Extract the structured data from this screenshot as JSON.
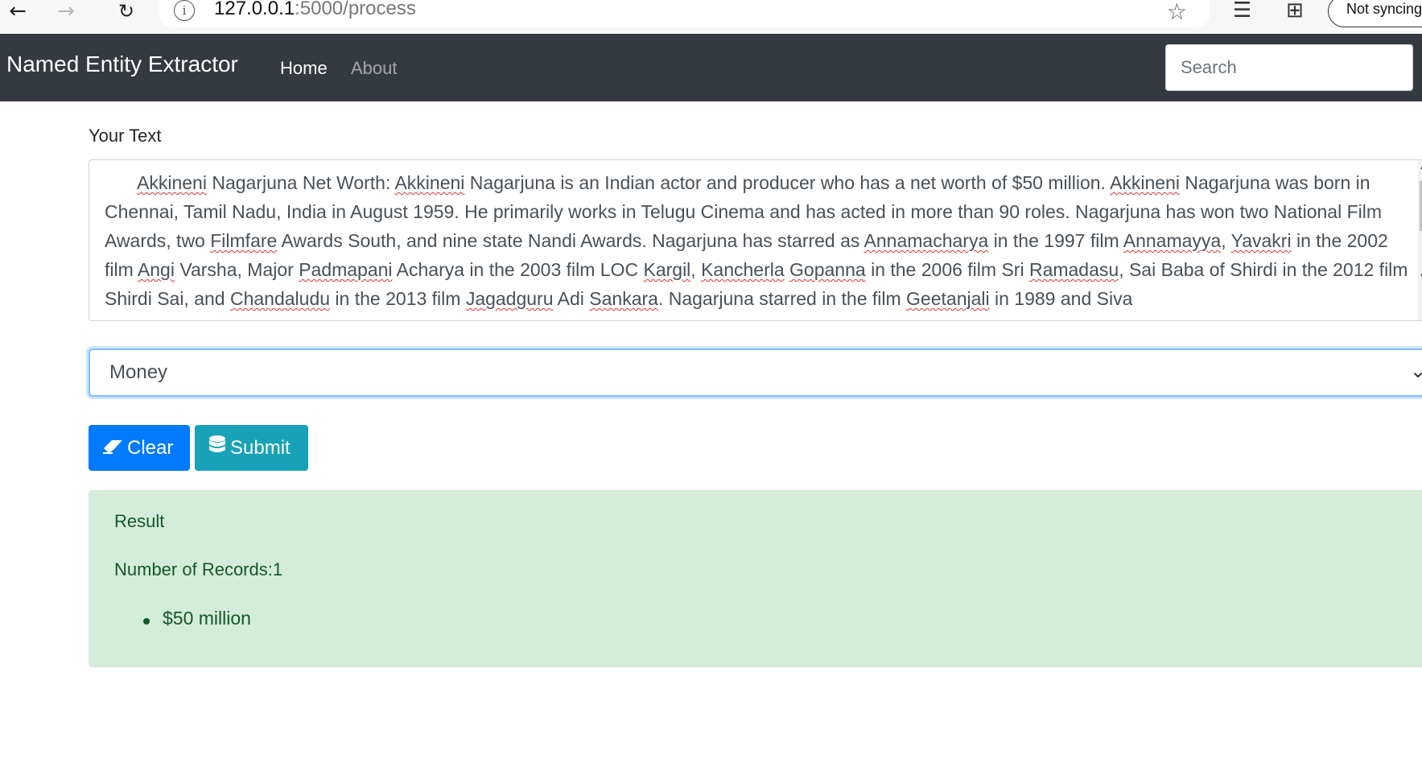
{
  "browser": {
    "url_host": "127.0.0.1",
    "url_path": ":5000/process",
    "sync_label": "Not syncing"
  },
  "navbar": {
    "brand": "Named Entity Extractor",
    "links": [
      "Home",
      "About"
    ],
    "search_placeholder": "Search"
  },
  "form": {
    "text_label": "Your Text",
    "text_value": "Akkineni Nagarjuna Net Worth: Akkineni Nagarjuna is an Indian actor and producer who has a net worth of $50 million. Akkineni Nagarjuna was born in Chennai, Tamil Nadu, India in August 1959. He primarily works in Telugu Cinema and has acted in more than 90 roles. Nagarjuna has won two National Film Awards, two Filmfare Awards South, and nine state Nandi Awards. Nagarjuna has starred as Annamacharya in the 1997 film Annamayya, Yavakri in the 2002 film Angi Varsha, Major Padmapani Acharya in the 2003 film LOC Kargil, Kancherla Gopanna in the 2006 film Sri Ramadasu, Sai Baba of Shirdi in the 2012 film Shirdi Sai, and Chandaludu in the 2013 film Jagadguru Adi Sankara. Nagarjuna starred in the film Geetanjali in 1989 and Siva",
    "entity_type": "Money",
    "clear_label": "Clear",
    "submit_label": "Submit"
  },
  "result": {
    "title": "Result",
    "count_text": "Number of Records:1",
    "items": [
      "$50 million"
    ]
  },
  "colors": {
    "navbar_bg": "#343a40",
    "primary": "#007bff",
    "info": "#17a2b8",
    "success_bg": "#d4edda",
    "success_text": "#155724"
  },
  "icons": {
    "back": "arrow-left-icon",
    "forward": "arrow-right-icon",
    "reload": "reload-icon",
    "info": "info-icon",
    "favorite": "star-icon",
    "favorites_list": "favorites-list-icon",
    "collections": "collections-icon",
    "clear": "eraser-icon",
    "submit": "database-icon",
    "dropdown": "chevron-down-icon"
  }
}
